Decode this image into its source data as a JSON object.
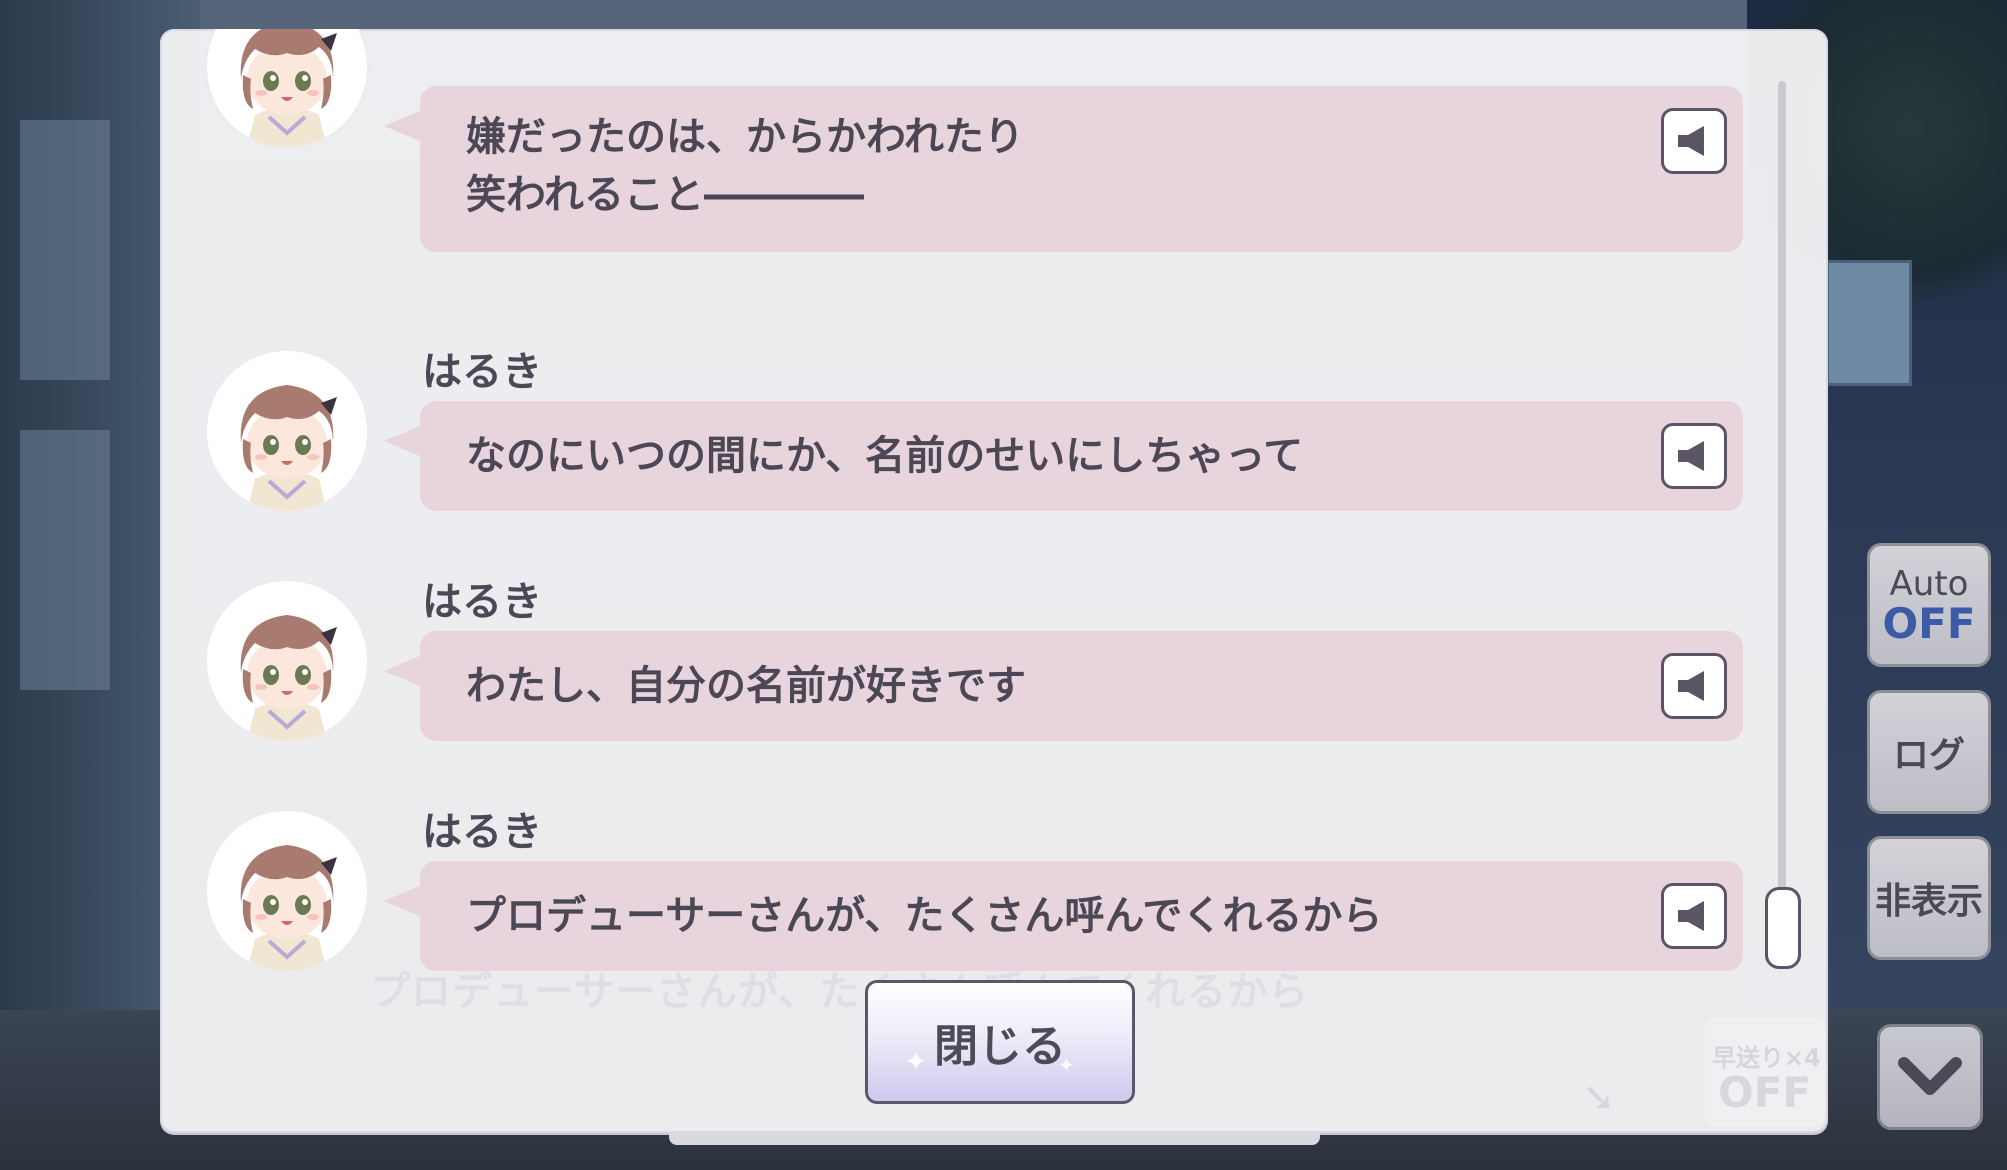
{
  "log": {
    "entries": [
      {
        "speaker": "",
        "lines": [
          "嫌だったのは、からかわれたり",
          "笑われること――――"
        ]
      },
      {
        "speaker": "はるき",
        "lines": [
          "なのにいつの間にか、名前のせいにしちゃって"
        ]
      },
      {
        "speaker": "はるき",
        "lines": [
          "わたし、自分の名前が好きです"
        ]
      },
      {
        "speaker": "はるき",
        "lines": [
          "プロデューサーさんが、たくさん呼んでくれるから"
        ]
      }
    ],
    "close_label": "閉じる"
  },
  "background": {
    "ghost_line": "プロデューサーさんが、たくさん呼んでくれるから"
  },
  "controls": {
    "auto_label": "Auto",
    "auto_state": "OFF",
    "log_label": "ログ",
    "hide_label": "非表示",
    "fast_forward_label": "早送り×4",
    "fast_forward_state": "OFF"
  },
  "icons": {
    "voice": "speaker-icon",
    "down": "chevron-down-icon"
  },
  "colors": {
    "bubble": "#e7d4dd",
    "text": "#4c4755",
    "auto_off": "#3c5aa6"
  }
}
